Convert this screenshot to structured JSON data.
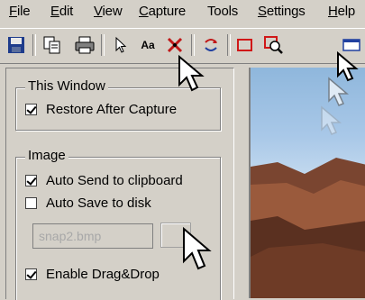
{
  "menu": [
    {
      "label": "File",
      "mnemonic": "F",
      "rest": "ile"
    },
    {
      "label": "Edit",
      "mnemonic": "E",
      "rest": "dit"
    },
    {
      "label": "View",
      "mnemonic": "V",
      "rest": "iew"
    },
    {
      "label": "Capture",
      "mnemonic": "C",
      "rest": "apture"
    },
    {
      "label": "Tools",
      "mnemonic": "",
      "rest": "Tools"
    },
    {
      "label": "Settings",
      "mnemonic": "S",
      "rest": "ettings"
    },
    {
      "label": "Help",
      "mnemonic": "H",
      "rest": "elp"
    }
  ],
  "toolbar": {
    "icons": [
      "save-icon",
      "copy-icon",
      "print-icon",
      "select-arrow-icon",
      "text-capture-icon",
      "crosshair-icon",
      "rotate-icon",
      "rectangle-icon",
      "zoom-region-icon",
      "window-icon"
    ],
    "text_tool_label": "Aa"
  },
  "this_window": {
    "title": "This Window",
    "restore_label": "Restore After Capture",
    "restore_checked": true
  },
  "image": {
    "title": "Image",
    "auto_send_label": "Auto Send to clipboard",
    "auto_send_checked": true,
    "auto_save_label": "Auto Save to disk",
    "auto_save_checked": false,
    "filename_value": "snap2.bmp",
    "enable_drag_label": "Enable Drag&Drop",
    "enable_drag_checked": true
  },
  "colors": {
    "window_bg": "#d4d0c8",
    "save_icon": "#1e3c8c",
    "crosshair_icon": "#c01818",
    "rectangle_icon": "#d01818",
    "window_icon": "#2040a0",
    "sky": "#a9c8e8",
    "rock": "#8a4a32"
  }
}
